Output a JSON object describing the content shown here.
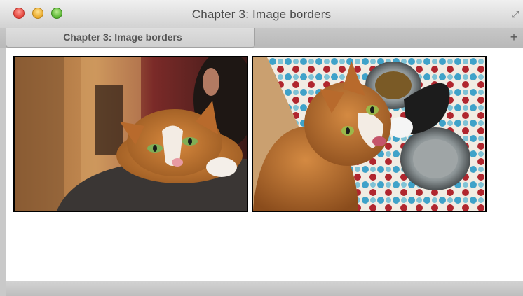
{
  "window": {
    "title": "Chapter 3: Image borders"
  },
  "tabs": [
    {
      "label": "Chapter 3: Image borders"
    }
  ],
  "toolbar": {
    "new_tab": "+"
  },
  "images": [
    {
      "alt": "Ginger cat resting on a person's shoulder"
    },
    {
      "alt": "Ginger cat looking up beside a food bowl"
    }
  ]
}
